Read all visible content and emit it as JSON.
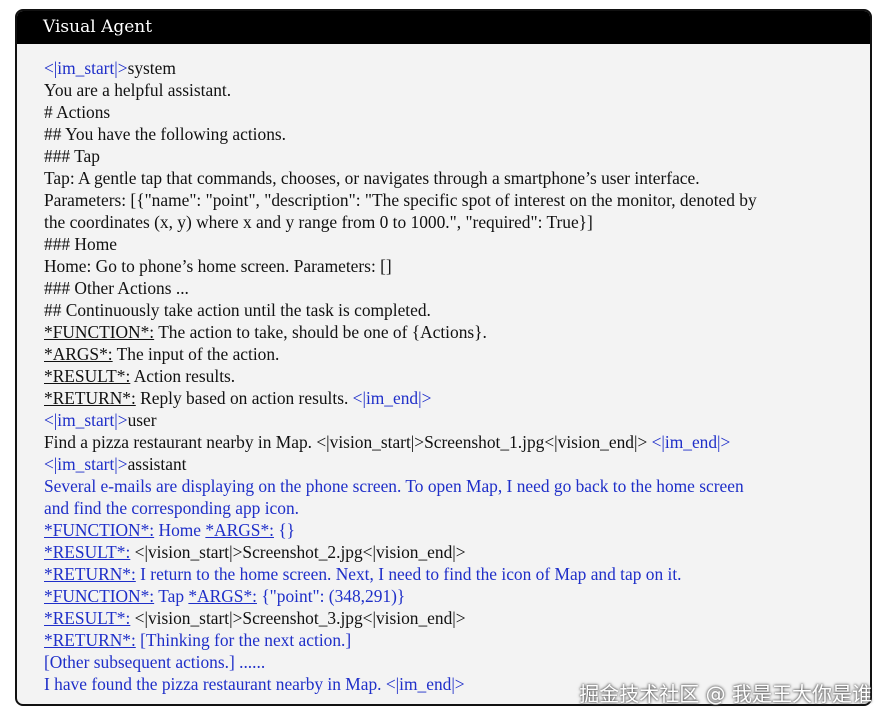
{
  "title": "Visual Agent",
  "lines": [
    {
      "runs": [
        {
          "t": "<|im_start|>",
          "c": "b"
        },
        {
          "t": "system"
        }
      ]
    },
    {
      "runs": [
        {
          "t": "You are a helpful assistant."
        }
      ]
    },
    {
      "runs": [
        {
          "t": "# Actions"
        }
      ]
    },
    {
      "runs": [
        {
          "t": "## You have the following actions."
        }
      ]
    },
    {
      "runs": [
        {
          "t": "### Tap"
        }
      ]
    },
    {
      "runs": [
        {
          "t": "Tap:  A gentle tap that commands, chooses, or navigates through a smartphone’s user interface."
        }
      ]
    },
    {
      "runs": [
        {
          "t": "Parameters: [{\"name\": \"point\", \"description\": \"The specific spot of interest on the monitor, denoted by"
        }
      ]
    },
    {
      "runs": [
        {
          "t": "the coordinates (x, y) where x and y range from 0 to 1000.\", \"required\": True}]"
        }
      ]
    },
    {
      "runs": [
        {
          "t": "### Home"
        }
      ]
    },
    {
      "runs": [
        {
          "t": "Home: Go to phone’s home screen. Parameters: []"
        }
      ]
    },
    {
      "runs": [
        {
          "t": "### Other Actions ..."
        }
      ]
    },
    {
      "runs": [
        {
          "t": "## Continuously take action until the task is completed."
        }
      ]
    },
    {
      "runs": [
        {
          "t": "*FUNCTION*:",
          "u": true
        },
        {
          "t": " The action to take, should be one of {Actions}."
        }
      ]
    },
    {
      "runs": [
        {
          "t": "*ARGS*:",
          "u": true
        },
        {
          "t": " The input of the action."
        }
      ]
    },
    {
      "runs": [
        {
          "t": "*RESULT*:",
          "u": true
        },
        {
          "t": " Action results."
        }
      ]
    },
    {
      "runs": [
        {
          "t": "*RETURN*:",
          "u": true
        },
        {
          "t": " Reply based on action results. "
        },
        {
          "t": "<|im_end|>",
          "c": "b"
        }
      ]
    },
    {
      "runs": [
        {
          "t": "<|im_start|>",
          "c": "b"
        },
        {
          "t": "user"
        }
      ]
    },
    {
      "runs": [
        {
          "t": "Find a pizza restaurant nearby in Map. <|vision_start|>Screenshot_1.jpg<|vision_end|> "
        },
        {
          "t": "<|im_end|>",
          "c": "b"
        }
      ]
    },
    {
      "runs": [
        {
          "t": "<|im_start|>",
          "c": "b"
        },
        {
          "t": "assistant"
        }
      ]
    },
    {
      "runs": [
        {
          "t": "Several e-mails are displaying on the phone screen. To open Map, I need go back to the home screen",
          "c": "b"
        }
      ]
    },
    {
      "runs": [
        {
          "t": "and find the corresponding app icon.",
          "c": "b"
        }
      ]
    },
    {
      "runs": [
        {
          "t": "*FUNCTION*:",
          "c": "b",
          "u": true
        },
        {
          "t": " Home ",
          "c": "b"
        },
        {
          "t": "*ARGS*:",
          "c": "b",
          "u": true
        },
        {
          "t": " {}",
          "c": "b"
        }
      ]
    },
    {
      "runs": [
        {
          "t": "*RESULT*:",
          "c": "b",
          "u": true
        },
        {
          "t": " <|vision_start|>Screenshot_2.jpg<|vision_end|>"
        }
      ]
    },
    {
      "runs": [
        {
          "t": "*RETURN*:",
          "c": "b",
          "u": true
        },
        {
          "t": " I return to the home screen. Next, I need to find the icon of Map and tap on it.",
          "c": "b"
        }
      ]
    },
    {
      "runs": [
        {
          "t": "*FUNCTION*:",
          "c": "b",
          "u": true
        },
        {
          "t": " Tap ",
          "c": "b"
        },
        {
          "t": "*ARGS*:",
          "c": "b",
          "u": true
        },
        {
          "t": " {\"point\": (348,291)}",
          "c": "b"
        }
      ]
    },
    {
      "runs": [
        {
          "t": "*RESULT*:",
          "c": "b",
          "u": true
        },
        {
          "t": " <|vision_start|>Screenshot_3.jpg<|vision_end|>"
        }
      ]
    },
    {
      "runs": [
        {
          "t": "*RETURN*:",
          "c": "b",
          "u": true
        },
        {
          "t": " [Thinking for the next action.]",
          "c": "b"
        }
      ]
    },
    {
      "runs": [
        {
          "t": "[Other subsequent actions.] ......",
          "c": "b"
        }
      ]
    },
    {
      "runs": [
        {
          "t": "I have found the pizza restaurant nearby in Map. <|im_end|>",
          "c": "b"
        }
      ]
    }
  ],
  "watermark": "掘金技术社区 @ 我是王大你是谁",
  "colors": {
    "blue": "#1f2fc9",
    "text": "#111111",
    "panel_bg": "#f3f3f3",
    "title_bg": "#000000"
  }
}
